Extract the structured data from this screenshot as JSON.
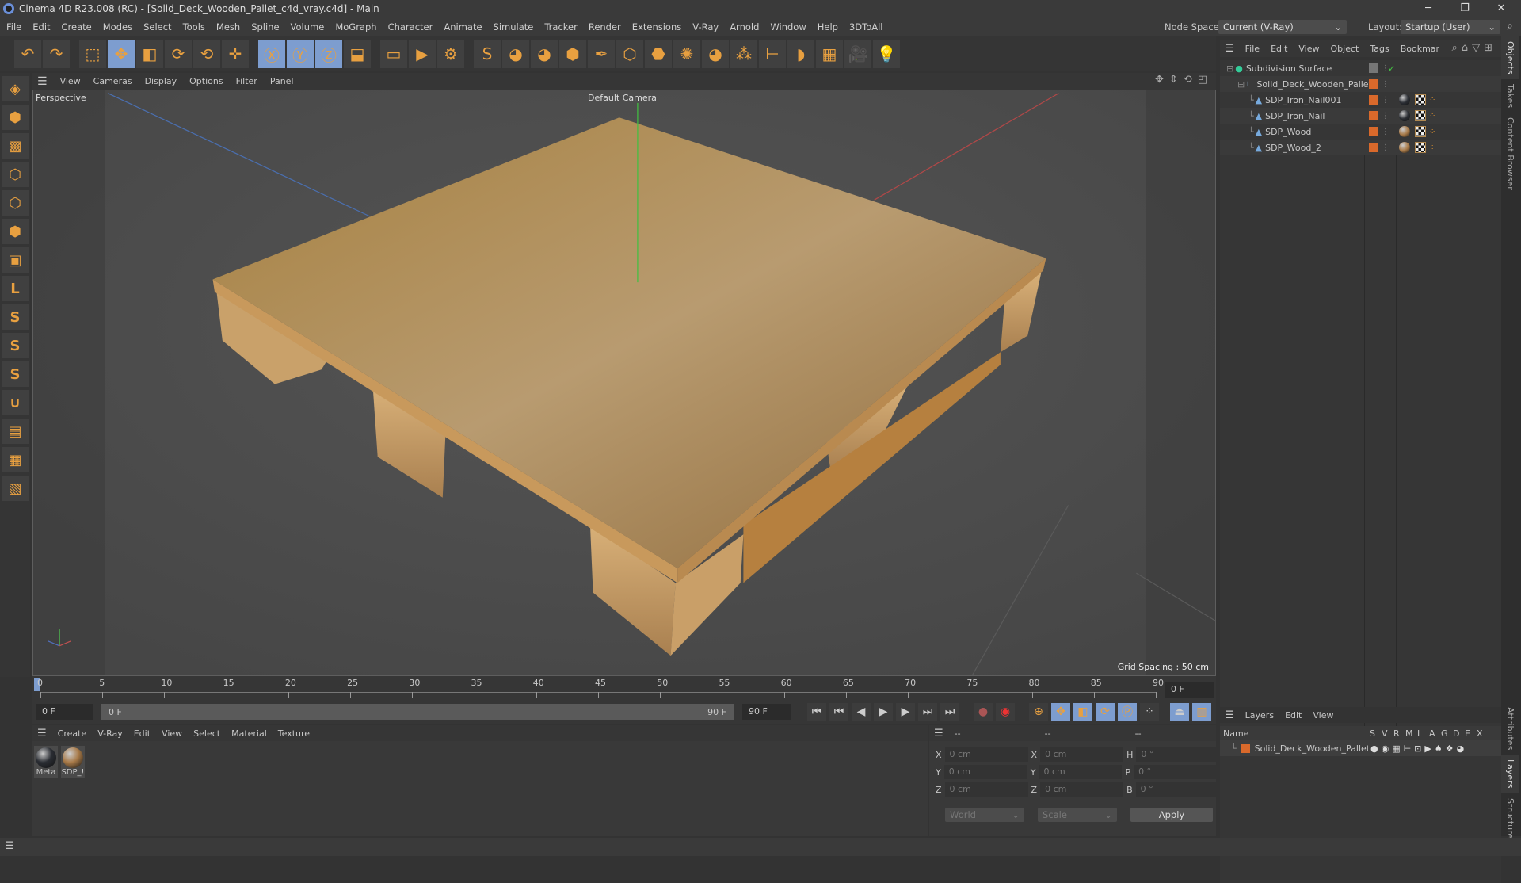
{
  "window": {
    "title": "Cinema 4D R23.008 (RC) - [Solid_Deck_Wooden_Pallet_c4d_vray.c4d] - Main",
    "minimize": "─",
    "restore": "❐",
    "close": "✕"
  },
  "menu": [
    "File",
    "Edit",
    "Create",
    "Modes",
    "Select",
    "Tools",
    "Mesh",
    "Spline",
    "Volume",
    "MoGraph",
    "Character",
    "Animate",
    "Simulate",
    "Tracker",
    "Render",
    "Extensions",
    "V-Ray",
    "Arnold",
    "Window",
    "Help",
    "3DToAll"
  ],
  "node_space": {
    "label": "Node Space:",
    "value": "Current (V-Ray)"
  },
  "layout": {
    "label": "Layout:",
    "value": "Startup (User)"
  },
  "toolbar": [
    {
      "icon": "undo-icon",
      "g": "↶"
    },
    {
      "icon": "redo-icon",
      "g": "↷"
    },
    {
      "icon": "select-icon",
      "g": "⬚",
      "gap": 1
    },
    {
      "icon": "move-icon",
      "g": "✥",
      "hl": 1
    },
    {
      "icon": "scale-icon",
      "g": "◧"
    },
    {
      "icon": "rotate-icon",
      "g": "⟳"
    },
    {
      "icon": "psr-icon",
      "g": "⟲"
    },
    {
      "icon": "transform-icon",
      "g": "✛"
    },
    {
      "icon": "x-axis-icon",
      "g": "Ⓧ",
      "hl": 1,
      "gap": 1
    },
    {
      "icon": "y-axis-icon",
      "g": "Ⓨ",
      "hl": 1
    },
    {
      "icon": "z-axis-icon",
      "g": "Ⓩ",
      "hl": 1
    },
    {
      "icon": "coordinate-system-icon",
      "g": "⬓"
    },
    {
      "icon": "render-region-icon",
      "g": "▭",
      "gap": 1
    },
    {
      "icon": "render-view-icon",
      "g": "▶"
    },
    {
      "icon": "render-settings-icon",
      "g": "⚙"
    },
    {
      "icon": "vray-icon",
      "g": "S",
      "gap": 1
    },
    {
      "icon": "python-icon",
      "g": "◕"
    },
    {
      "icon": "python-icon-2",
      "g": "◕"
    },
    {
      "icon": "cube-icon",
      "g": "⬢"
    },
    {
      "icon": "pen-icon",
      "g": "✒"
    },
    {
      "icon": "subdivision-icon",
      "g": "⬡"
    },
    {
      "icon": "extrude-icon",
      "g": "⬣"
    },
    {
      "icon": "cloner-icon",
      "g": "✺"
    },
    {
      "icon": "python-icon-3",
      "g": "◕"
    },
    {
      "icon": "mograph-icon",
      "g": "⁂"
    },
    {
      "icon": "measure-icon",
      "g": "⊢"
    },
    {
      "icon": "deformer-icon",
      "g": "◗"
    },
    {
      "icon": "floor-icon",
      "g": "▦"
    },
    {
      "icon": "camera-icon",
      "g": "🎥"
    },
    {
      "icon": "light-icon",
      "g": "💡"
    }
  ],
  "left_tools": [
    {
      "icon": "make-editable-icon",
      "g": "◈"
    },
    {
      "icon": "model-mode-icon",
      "g": "⬢"
    },
    {
      "icon": "texture-mode-icon",
      "g": "▩"
    },
    {
      "icon": "points-mode-icon",
      "g": "⬡"
    },
    {
      "icon": "edges-mode-icon",
      "g": "⬡"
    },
    {
      "icon": "polygons-mode-icon",
      "g": "⬢"
    },
    {
      "icon": "uvw-mode-icon",
      "g": "▣"
    },
    {
      "icon": "axis-mode-icon",
      "g": "L"
    },
    {
      "icon": "snap-icon",
      "g": "S"
    },
    {
      "icon": "snap-settings-icon",
      "g": "S"
    },
    {
      "icon": "snap-extra-icon",
      "g": "S"
    },
    {
      "icon": "magnet-icon",
      "g": "∪"
    },
    {
      "icon": "workplane-icon",
      "g": "▤"
    },
    {
      "icon": "grid-icon",
      "g": "▦"
    },
    {
      "icon": "lock-workplane-icon",
      "g": "▧"
    }
  ],
  "viewport": {
    "menu": [
      "View",
      "Cameras",
      "Display",
      "Options",
      "Filter",
      "Panel"
    ],
    "label": "Perspective",
    "camera": "Default Camera",
    "grid_spacing": "Grid Spacing : 50 cm"
  },
  "timeline": {
    "ticks": [
      "0",
      "5",
      "10",
      "15",
      "20",
      "25",
      "30",
      "35",
      "40",
      "45",
      "50",
      "55",
      "60",
      "65",
      "70",
      "75",
      "80",
      "85",
      "90"
    ],
    "current": "0 F",
    "start": "0 F",
    "slider_start": "0 F",
    "slider_end": "90 F",
    "end": "90 F"
  },
  "materials": {
    "menu": [
      "Create",
      "V-Ray",
      "Edit",
      "View",
      "Select",
      "Material",
      "Texture"
    ],
    "items": [
      {
        "name": "Meta",
        "color": "#2a2d33"
      },
      {
        "name": "SDP_!",
        "color": "#a87a48"
      }
    ]
  },
  "coords": {
    "headers": [
      "--",
      "--",
      "--"
    ],
    "rows": [
      {
        "a": "X",
        "av": "0 cm",
        "b": "X",
        "bv": "0 cm",
        "c": "H",
        "cv": "0 °"
      },
      {
        "a": "Y",
        "av": "0 cm",
        "b": "Y",
        "bv": "0 cm",
        "c": "P",
        "cv": "0 °"
      },
      {
        "a": "Z",
        "av": "0 cm",
        "b": "Z",
        "bv": "0 cm",
        "c": "B",
        "cv": "0 °"
      }
    ],
    "world": "World",
    "scale": "Scale",
    "apply": "Apply"
  },
  "objects": {
    "menu": [
      "File",
      "Edit",
      "View",
      "Object",
      "Tags",
      "Bookmar"
    ],
    "items": [
      {
        "name": "Subdivision Surface",
        "indent": 0
      },
      {
        "name": "Solid_Deck_Wooden_Pallet",
        "indent": 1
      },
      {
        "name": "SDP_Iron_Nail001",
        "indent": 2,
        "mat": "#2a2d33"
      },
      {
        "name": "SDP_Iron_Nail",
        "indent": 2,
        "mat": "#2a2d33"
      },
      {
        "name": "SDP_Wood",
        "indent": 2,
        "mat": "#a87a48"
      },
      {
        "name": "SDP_Wood_2",
        "indent": 2,
        "mat": "#a87a48"
      }
    ]
  },
  "layers": {
    "menu": [
      "Layers",
      "Edit",
      "View"
    ],
    "columns": [
      "Name",
      "S",
      "V",
      "R",
      "M",
      "L",
      "A",
      "G",
      "D",
      "E",
      "X"
    ],
    "items": [
      {
        "name": "Solid_Deck_Wooden_Pallet"
      }
    ]
  },
  "side_tabs_top": [
    "Objects",
    "Takes",
    "Content Browser"
  ],
  "side_tabs_bottom": [
    "Attributes",
    "Layers",
    "Structure"
  ],
  "colors": {
    "accent": "#7d9dcf",
    "layer": "#d9692b",
    "wood": "#b08850"
  }
}
